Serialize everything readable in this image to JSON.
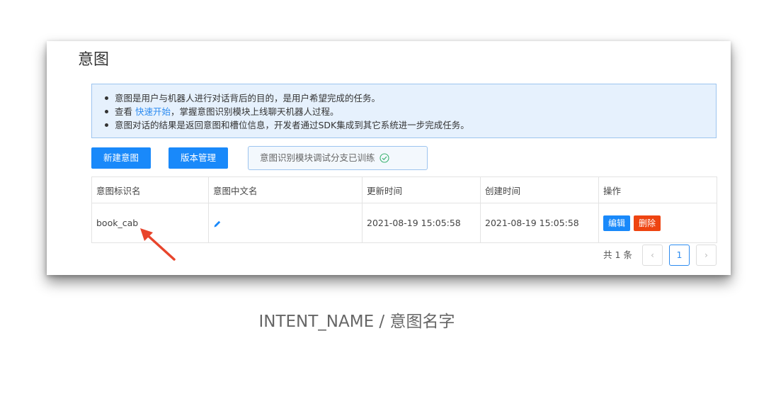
{
  "page": {
    "title": "意图"
  },
  "info": {
    "line1": "意图是用户与机器人进行对话背后的目的，是用户希望完成的任务。",
    "line2_prefix": "查看 ",
    "line2_link": "快速开始",
    "line2_suffix": "，掌握意图识别模块上线聊天机器人过程。",
    "line3": "意图对话的结果是返回意图和槽位信息，开发者通过SDK集成到其它系统进一步完成任务。"
  },
  "toolbar": {
    "new_intent_label": "新建意图",
    "version_label": "版本管理",
    "status_text": "意图识别模块调试分支已训练",
    "status_icon": "check-circle-icon"
  },
  "table": {
    "headers": [
      "意图标识名",
      "意图中文名",
      "更新时间",
      "创建时间",
      "操作"
    ],
    "rows": [
      {
        "name": "book_cab",
        "cn_name_icon": "pencil-icon",
        "updated": "2021-08-19 15:05:58",
        "created": "2021-08-19 15:05:58",
        "edit_label": "编辑",
        "delete_label": "删除"
      }
    ]
  },
  "pagination": {
    "total": "共 1 条",
    "prev": "‹",
    "current": "1",
    "next": "›"
  },
  "caption": "INTENT_NAME / 意图名字",
  "colors": {
    "primary": "#1989fa",
    "danger": "#ee4411",
    "info_bg": "#e6f1fd",
    "annotation_arrow": "#e8452c"
  }
}
